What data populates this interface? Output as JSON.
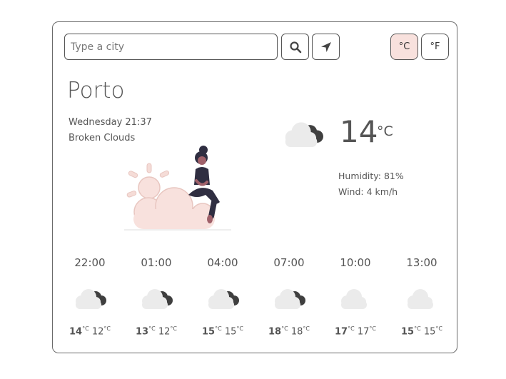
{
  "search": {
    "placeholder": "Type a city"
  },
  "units": {
    "celsius": "°C",
    "fahrenheit": "°F",
    "active": "celsius"
  },
  "current": {
    "city": "Porto",
    "datetime": "Wednesday 21:37",
    "description": "Broken Clouds",
    "temperature": "14",
    "unit": "°C",
    "humidity": "Humidity: 81%",
    "wind": "Wind: 4 km/h",
    "icon": "broken-clouds-icon"
  },
  "forecast": [
    {
      "time": "22:00",
      "high": "14",
      "low": "12",
      "unit": "°C",
      "icon": "broken-clouds-icon"
    },
    {
      "time": "01:00",
      "high": "13",
      "low": "12",
      "unit": "°C",
      "icon": "broken-clouds-icon"
    },
    {
      "time": "04:00",
      "high": "15",
      "low": "15",
      "unit": "°C",
      "icon": "broken-clouds-icon"
    },
    {
      "time": "07:00",
      "high": "18",
      "low": "18",
      "unit": "°C",
      "icon": "broken-clouds-icon"
    },
    {
      "time": "10:00",
      "high": "17",
      "low": "17",
      "unit": "°C",
      "icon": "few-clouds-icon"
    },
    {
      "time": "13:00",
      "high": "15",
      "low": "15",
      "unit": "°C",
      "icon": "few-clouds-icon"
    }
  ],
  "colors": {
    "accent": "#f8e1dd",
    "border": "#6a6a6a",
    "cloud_dark": "#3f3f3f",
    "cloud_light": "#eeeeee"
  }
}
